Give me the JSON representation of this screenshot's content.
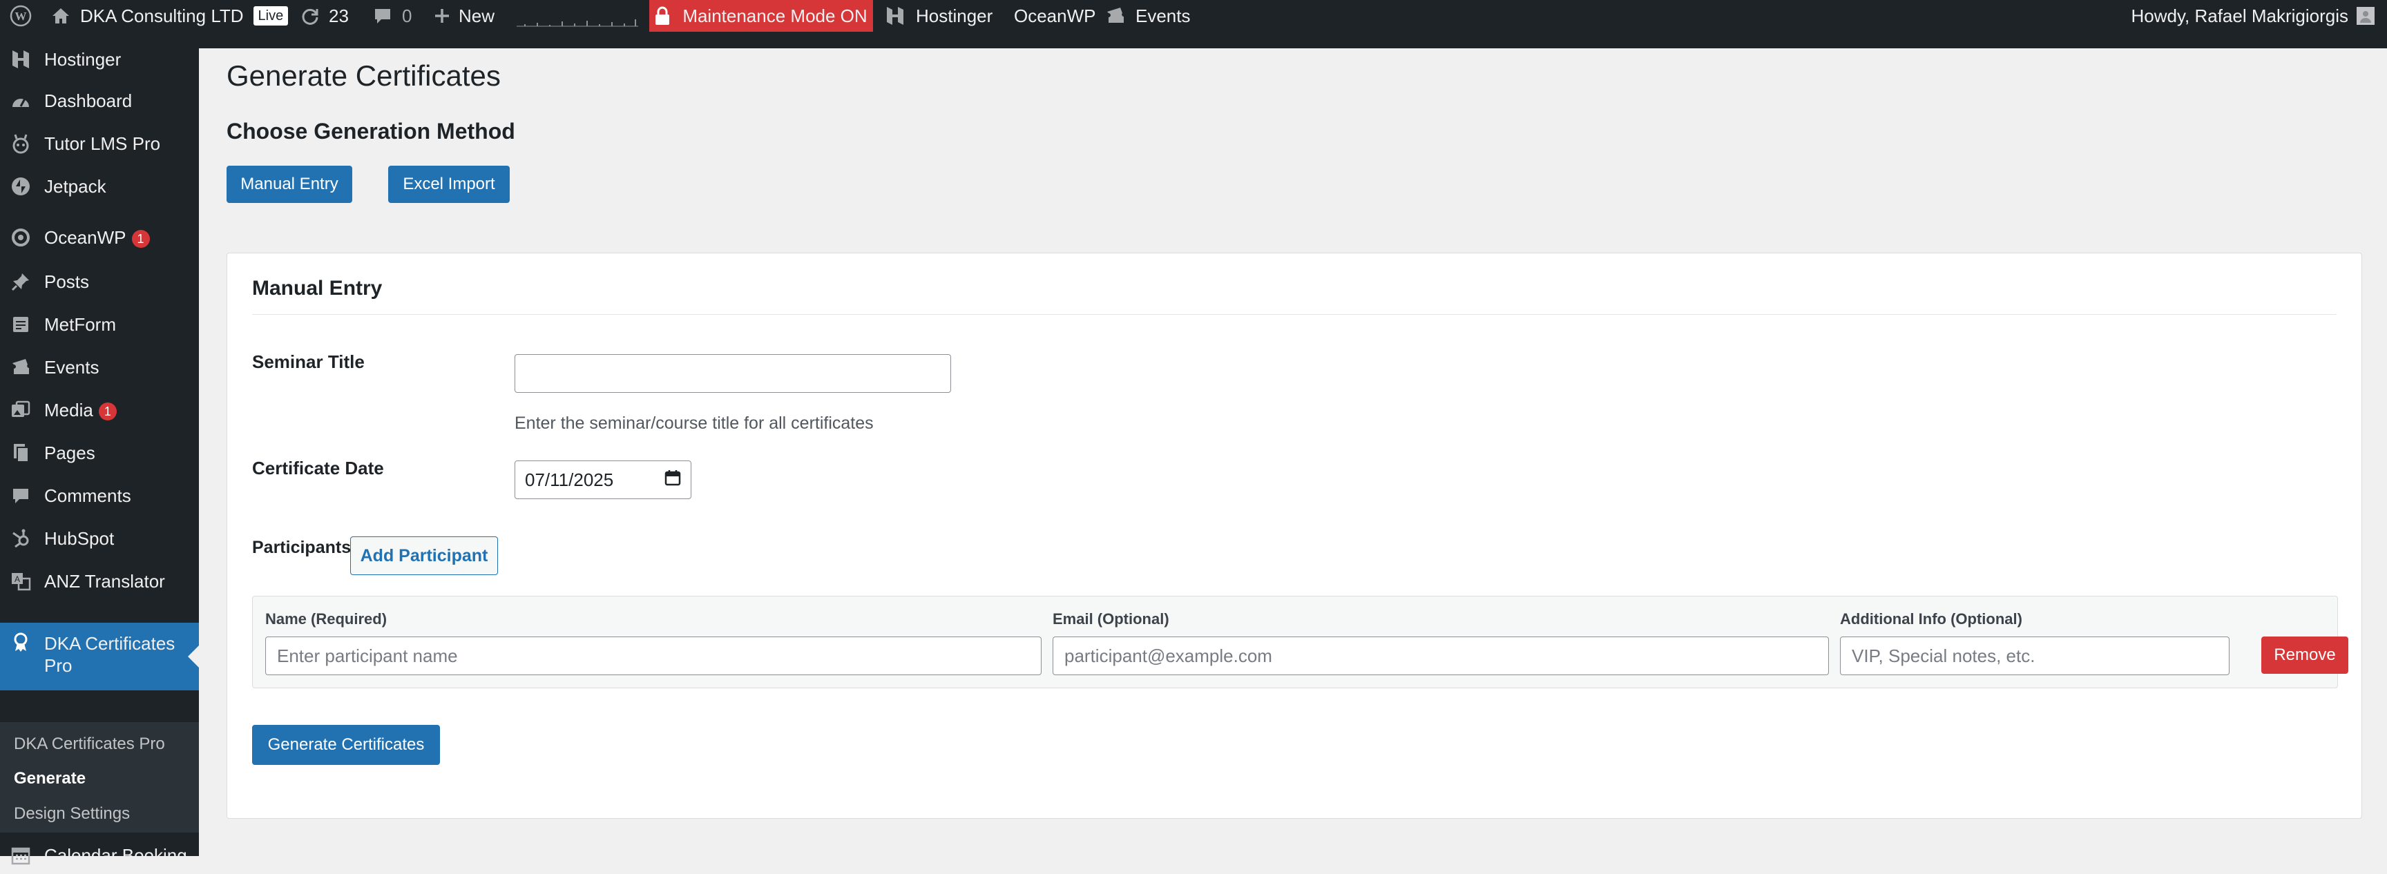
{
  "admin_bar": {
    "site_name": "DKA Consulting LTD",
    "live_badge": "Live",
    "updates_count": "23",
    "comments_count": "0",
    "new_label": "New",
    "maintenance_label": "Maintenance Mode ON",
    "hostinger_label": "Hostinger",
    "oceanwp_label": "OceanWP",
    "events_label": "Events",
    "howdy_text": "Howdy, Rafael Makrigiorgis"
  },
  "sidebar": {
    "items": [
      {
        "label": "Hostinger",
        "icon": "hostinger-icon"
      },
      {
        "label": "Dashboard",
        "icon": "dashboard-icon"
      },
      {
        "label": "Tutor LMS Pro",
        "icon": "tutor-icon"
      },
      {
        "label": "Jetpack",
        "icon": "jetpack-icon"
      },
      {
        "label": "OceanWP",
        "icon": "oceanwp-icon",
        "badge": "1"
      },
      {
        "label": "Posts",
        "icon": "pin-icon"
      },
      {
        "label": "MetForm",
        "icon": "form-icon"
      },
      {
        "label": "Events",
        "icon": "events-icon"
      },
      {
        "label": "Media",
        "icon": "media-icon",
        "badge": "1"
      },
      {
        "label": "Pages",
        "icon": "pages-icon"
      },
      {
        "label": "Comments",
        "icon": "comments-icon"
      },
      {
        "label": "HubSpot",
        "icon": "hubspot-icon"
      },
      {
        "label": "ANZ Translator",
        "icon": "translate-icon"
      },
      {
        "label": "DKA Certificates Pro",
        "icon": "certificate-icon"
      },
      {
        "label": "Calendar Booking",
        "icon": "calendar-icon"
      }
    ],
    "submenu": [
      "DKA Certificates Pro",
      "Generate",
      "Design Settings"
    ]
  },
  "main": {
    "page_title": "Generate Certificates",
    "method_title": "Choose Generation Method",
    "manual_button": "Manual Entry",
    "excel_button": "Excel Import",
    "card": {
      "title": "Manual Entry",
      "seminar_label": "Seminar Title",
      "seminar_value": "",
      "seminar_desc": "Enter the seminar/course title for all certificates",
      "date_label": "Certificate Date",
      "date_value": "07/11/2025",
      "participants_label": "Participants",
      "add_participant": "Add Participant",
      "columns": {
        "name": "Name (Required)",
        "email": "Email (Optional)",
        "info": "Additional Info (Optional)"
      },
      "placeholders": {
        "name": "Enter participant name",
        "email": "participant@example.com",
        "info": "VIP, Special notes, etc."
      },
      "remove_button": "Remove",
      "generate_button": "Generate Certificates"
    }
  },
  "colors": {
    "admin_dark": "#1d2327",
    "accent_blue": "#2271b1",
    "danger_red": "#d63638",
    "page_bg": "#f0f0f1"
  }
}
